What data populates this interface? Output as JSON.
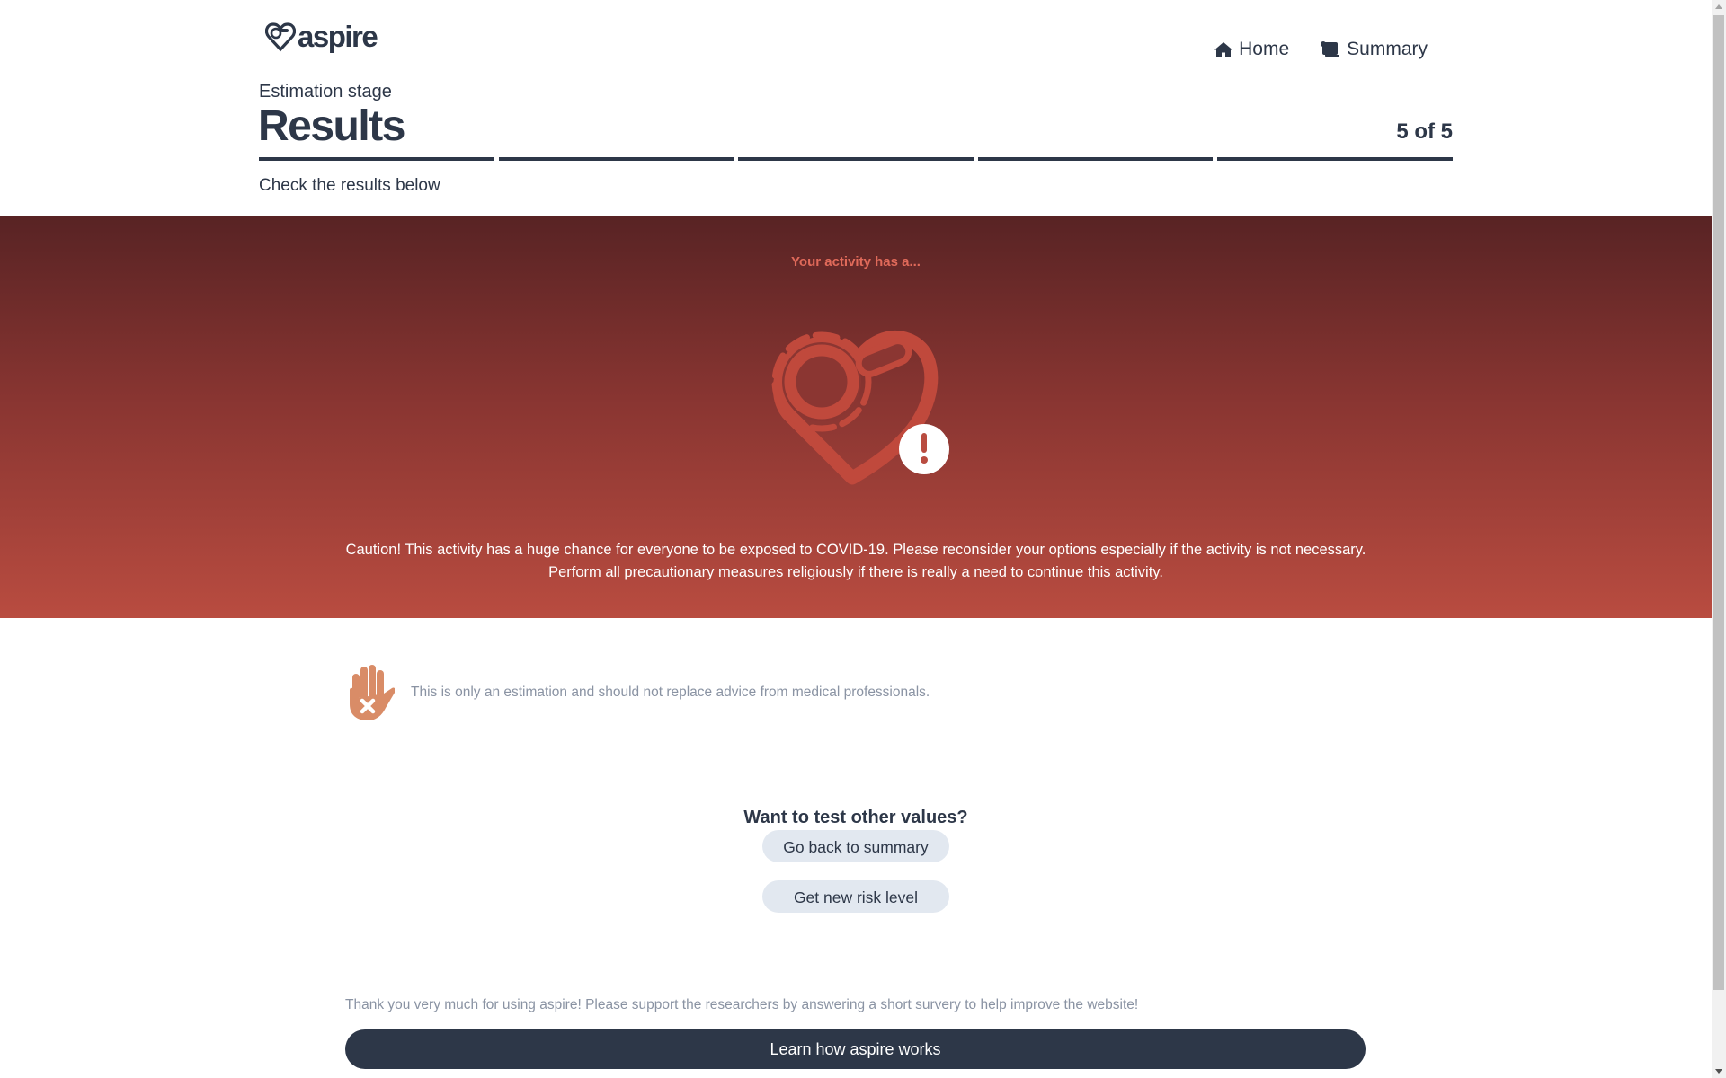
{
  "header": {
    "logo_text": "aspire",
    "nav": [
      {
        "label": "Home",
        "icon": "home-icon"
      },
      {
        "label": "Summary",
        "icon": "scroll-icon"
      }
    ]
  },
  "stage": {
    "label": "Estimation stage",
    "title": "Results",
    "step_count": "5 of 5",
    "current_step": 5,
    "total_steps": 5,
    "instruction": "Check the results below"
  },
  "result": {
    "kicker": "Your activity has a...",
    "illustration": "heart-virus-alert-icon",
    "message": "Caution! This activity has a huge chance for everyone to be exposed to COVID-19. Please reconsider your options especially if the activity is not necessary. Perform all precautionary measures religiously if there is really a need to continue this activity.",
    "colors": {
      "top": "#582324",
      "bottom": "#b94c40",
      "accent": "#e06a5a"
    }
  },
  "disclaimer": {
    "icon": "hand-stop-icon",
    "text": "This is only an estimation and should not replace advice from medical professionals."
  },
  "retry": {
    "heading": "Want to test other values?",
    "back_button": "Go back to summary",
    "new_button": "Get new risk level"
  },
  "footer": {
    "thanks": "Thank you very much for using aspire! Please support the researchers by answering a short survery to help improve the website!",
    "learn_button": "Learn how aspire works"
  },
  "colors": {
    "primary": "#2d3748",
    "button_light": "#e2e8f0",
    "muted_text": "#8a93a3"
  }
}
